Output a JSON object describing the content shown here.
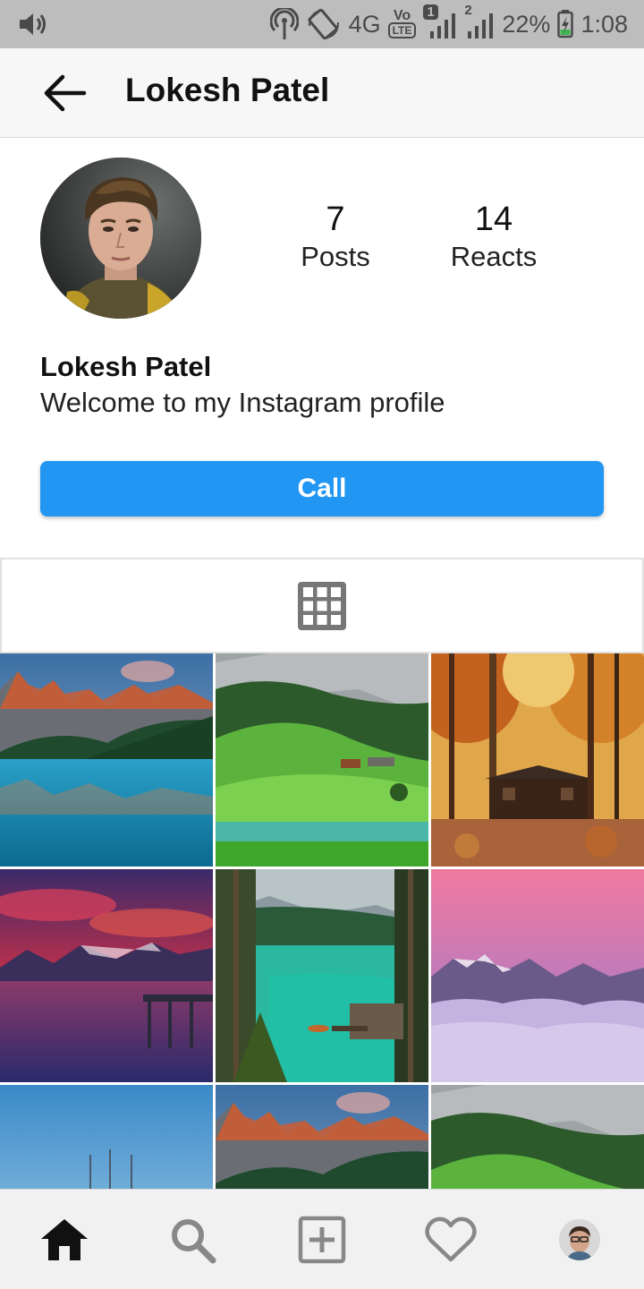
{
  "status_bar": {
    "network": "4G",
    "volte": "Vo",
    "lte": "LTE",
    "sim1_badge": "1",
    "sim2_badge": "2",
    "battery": "22%",
    "time": "1:08"
  },
  "app_bar": {
    "title": "Lokesh Patel"
  },
  "profile": {
    "name": "Lokesh Patel",
    "bio": "Welcome to my Instagram profile",
    "stats": [
      {
        "value": "7",
        "label": "Posts"
      },
      {
        "value": "14",
        "label": "Reacts"
      }
    ],
    "call_label": "Call"
  },
  "grid_tab": {
    "icon": "grid-icon"
  },
  "photos": [
    "lake-mountain-sunrise",
    "green-valley-lake",
    "autumn-forest-cabin",
    "sunset-lake-pier",
    "turquoise-lake-forest",
    "pink-sky-mountains-clouds",
    "blue-sky-poles",
    "mountain-sunrise",
    "green-valley"
  ],
  "bottom_nav": {
    "items": [
      "home-icon",
      "search-icon",
      "add-post-icon",
      "heart-icon",
      "profile-avatar"
    ]
  },
  "colors": {
    "accent": "#2196f3",
    "status_bar": "#bdbdbd",
    "app_bar": "#f7f7f7"
  }
}
